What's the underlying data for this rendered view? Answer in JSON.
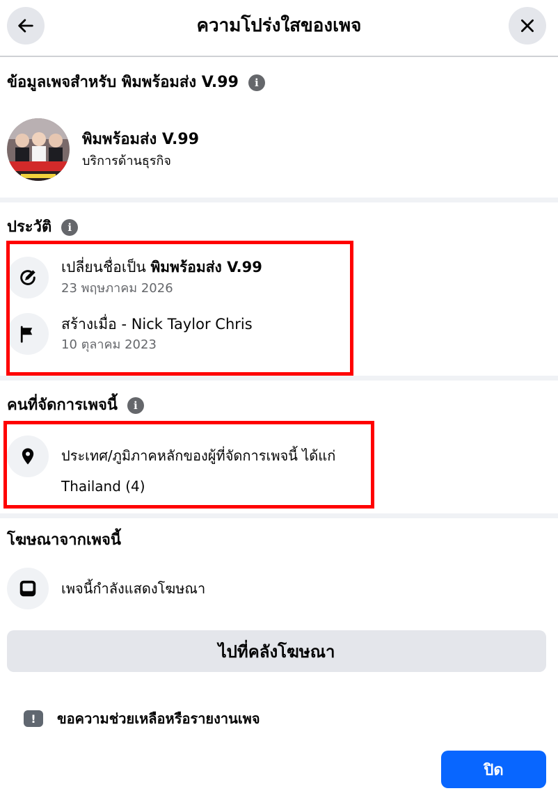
{
  "header": {
    "title": "ความโปร่งใสของเพจ",
    "back_icon": "arrow-left-icon",
    "close_icon": "close-icon"
  },
  "page_info": {
    "title": "ข้อมูลเพจสำหรับ พิมพร้อมส่ง V.99",
    "name": "พิมพร้อมส่ง V.99",
    "category": "บริการด้านธุรกิจ"
  },
  "history": {
    "title": "ประวัติ",
    "items": [
      {
        "icon": "edit-name-icon",
        "prefix": "เปลี่ยนชื่อเป็น ",
        "bold": "พิมพร้อมส่ง V.99",
        "date": "23 พฤษภาคม 2026"
      },
      {
        "icon": "flag-icon",
        "prefix": "สร้างเมื่อ - ",
        "bold": "Nick Taylor Chris",
        "date": "10 ตุลาคม 2023"
      }
    ]
  },
  "managers": {
    "title": "คนที่จัดการเพจนี้",
    "icon": "location-pin-icon",
    "description": "ประเทศ/ภูมิภาคหลักของผู้ที่จัดการเพจนี้ ได้แก่",
    "value": "Thailand (4)"
  },
  "ads": {
    "title": "โฆษณาจากเพจนี้",
    "icon": "ad-screen-icon",
    "status": "เพจนี้กำลังแสดงโฆษณา",
    "button_label": "ไปที่คลังโฆษณา"
  },
  "report": {
    "icon": "alert-icon",
    "label": "ขอความช่วยเหลือหรือรายงานเพจ"
  },
  "footer": {
    "close_label": "ปิด"
  },
  "colors": {
    "primary": "#0866ff",
    "highlight_border": "#ff0000",
    "secondary_text": "#65676b",
    "button_bg": "#e4e6eb"
  }
}
